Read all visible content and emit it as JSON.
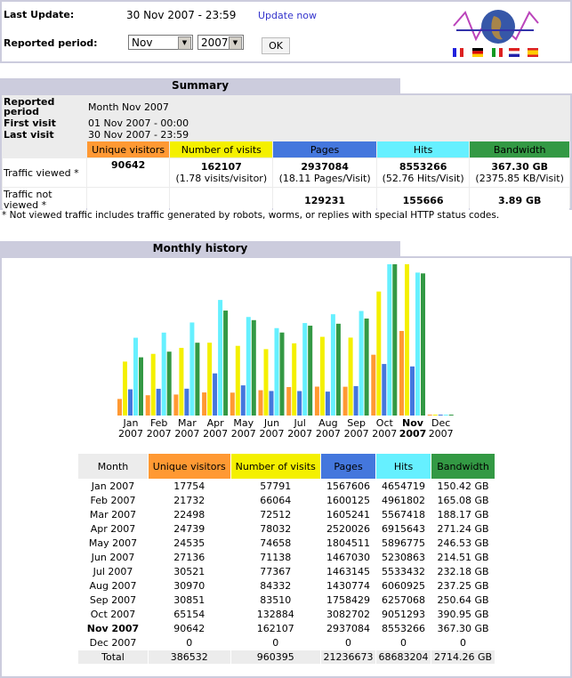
{
  "header": {
    "last_update_label": "Last Update:",
    "last_update_value": "30 Nov 2007 - 23:59",
    "update_now": "Update now",
    "period_label": "Reported period:",
    "month_select": "Nov",
    "year_select": "2007",
    "ok_button": "OK"
  },
  "summary": {
    "title": "Summary",
    "reported_period_label": "Reported period",
    "reported_period_value": "Month Nov 2007",
    "first_visit_label": "First visit",
    "first_visit_value": "01 Nov 2007 - 00:00",
    "last_visit_label": "Last visit",
    "last_visit_value": "30 Nov 2007 - 23:59",
    "columns": [
      "Unique visitors",
      "Number of visits",
      "Pages",
      "Hits",
      "Bandwidth"
    ],
    "viewed_label": "Traffic viewed *",
    "viewed": [
      "90642",
      "162107",
      "2937084",
      "8553266",
      "367.30 GB"
    ],
    "viewed_sub": [
      "",
      "(1.78 visits/visitor)",
      "(18.11 Pages/Visit)",
      "(52.76 Hits/Visit)",
      "(2375.85 KB/Visit)"
    ],
    "not_viewed_label": "Traffic not viewed *",
    "not_viewed": [
      "",
      "",
      "129231",
      "155666",
      "3.89 GB"
    ],
    "footnote": "* Not viewed traffic includes traffic generated by robots, worms, or replies with special HTTP status codes."
  },
  "history": {
    "title": "Monthly history",
    "columns": [
      "Month",
      "Unique visitors",
      "Number of visits",
      "Pages",
      "Hits",
      "Bandwidth"
    ],
    "rows": [
      [
        "Jan 2007",
        "17754",
        "57791",
        "1567606",
        "4654719",
        "150.42 GB"
      ],
      [
        "Feb 2007",
        "21732",
        "66064",
        "1600125",
        "4961802",
        "165.08 GB"
      ],
      [
        "Mar 2007",
        "22498",
        "72512",
        "1605241",
        "5567418",
        "188.17 GB"
      ],
      [
        "Apr 2007",
        "24739",
        "78032",
        "2520026",
        "6915643",
        "271.24 GB"
      ],
      [
        "May 2007",
        "24535",
        "74658",
        "1804511",
        "5896775",
        "246.53 GB"
      ],
      [
        "Jun 2007",
        "27136",
        "71138",
        "1467030",
        "5230863",
        "214.51 GB"
      ],
      [
        "Jul 2007",
        "30521",
        "77367",
        "1463145",
        "5533432",
        "232.18 GB"
      ],
      [
        "Aug 2007",
        "30970",
        "84332",
        "1430774",
        "6060925",
        "237.25 GB"
      ],
      [
        "Sep 2007",
        "30851",
        "83510",
        "1758429",
        "6257068",
        "250.64 GB"
      ],
      [
        "Oct 2007",
        "65154",
        "132884",
        "3082702",
        "9051293",
        "390.95 GB"
      ],
      [
        "Nov 2007",
        "90642",
        "162107",
        "2937084",
        "8553266",
        "367.30 GB"
      ],
      [
        "Dec 2007",
        "0",
        "0",
        "0",
        "0",
        "0"
      ]
    ],
    "total": [
      "Total",
      "386532",
      "960395",
      "21236673",
      "68683204",
      "2714.26 GB"
    ],
    "chart_labels": [
      [
        "Jan",
        "2007"
      ],
      [
        "Feb",
        "2007"
      ],
      [
        "Mar",
        "2007"
      ],
      [
        "Apr",
        "2007"
      ],
      [
        "May",
        "2007"
      ],
      [
        "Jun",
        "2007"
      ],
      [
        "Jul",
        "2007"
      ],
      [
        "Aug",
        "2007"
      ],
      [
        "Sep",
        "2007"
      ],
      [
        "Oct",
        "2007"
      ],
      [
        "Nov",
        "2007"
      ],
      [
        "Dec",
        "2007"
      ]
    ],
    "current_index": 10
  },
  "colors": {
    "visitors": "#f93",
    "visits": "#f4f000",
    "pages": "#4477dd",
    "hits": "#66f0ff",
    "bandwidth": "#339944"
  }
}
